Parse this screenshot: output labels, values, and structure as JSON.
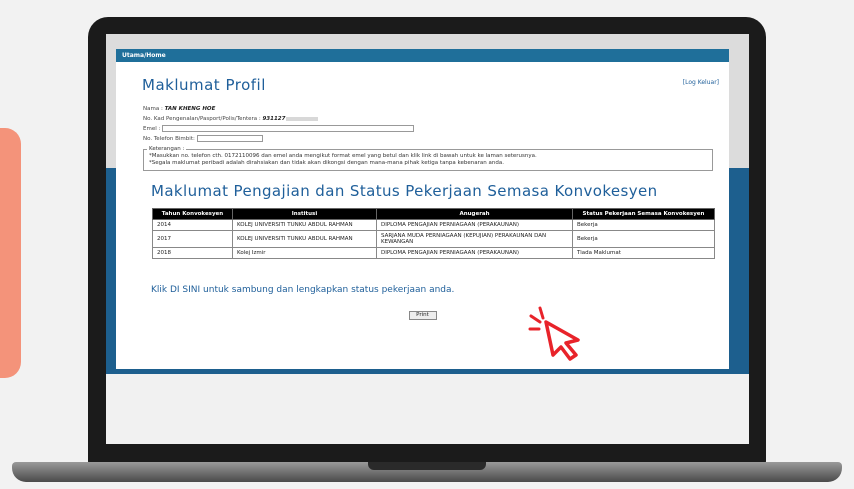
{
  "nav": {
    "home": "Utama/Home"
  },
  "header": {
    "logout": "[Log Keluar]",
    "title": "Maklumat Profil"
  },
  "profile": {
    "name_label": "Nama :",
    "name_value": "TAN KHENG HOE",
    "ic_label": "No. Kad Pengenalan/Pasport/Polis/Tentera :",
    "ic_value": "931127",
    "email_label": "Emel :",
    "email_value": "",
    "phone_label": "No. Telefon Bimbit:",
    "phone_value": ""
  },
  "notes": {
    "legend": "Keterangan :",
    "line1": "*Masukkan no. telefon cth. 0172110096 dan emel anda mengikut format emel yang betul dan klik link di bawah untuk ke laman seterusnya.",
    "line2": "*Segala maklumat peribadi adalah dirahsiakan dan tidak akan dikongsi dengan mana-mana pihak ketiga tanpa kebenaran anda."
  },
  "section2": {
    "title": "Maklumat Pengajian dan Status Pekerjaan Semasa Konvokesyen"
  },
  "table": {
    "headers": [
      "Tahun Konvokesyen",
      "Institusi",
      "Anugerah",
      "Status Pekerjaan Semasa Konvokesyen"
    ],
    "rows": [
      [
        "2014",
        "KOLEJ UNIVERSITI TUNKU ABDUL RAHMAN",
        "DIPLOMA PENGAJIAN PERNIAGAAN (PERAKAUNAN)",
        "Bekerja"
      ],
      [
        "2017",
        "KOLEJ UNIVERSITI TUNKU ABDUL RAHMAN",
        "SARJANA MUDA PERNIAGAAN (KEPUJIAN) PERAKAUNAN DAN KEWANGAN",
        "Bekerja"
      ],
      [
        "2018",
        "Kolej Izmir",
        "DIPLOMA PENGAJIAN PERNIAGAAN (PERAKAUNAN)",
        "Tiada Maklumat"
      ]
    ]
  },
  "cta": {
    "link_text": "Klik DI SINI untuk sambung dan lengkapkan status pekerjaan anda."
  },
  "print": {
    "label": "Print"
  },
  "icons": {
    "cursor": "click-pointer-icon"
  },
  "colors": {
    "accent": "#1f5f9a",
    "navbar": "#1f6f9a",
    "band": "#1d5f8e",
    "cursor": "#e8232a",
    "orange": "#f4937a"
  }
}
